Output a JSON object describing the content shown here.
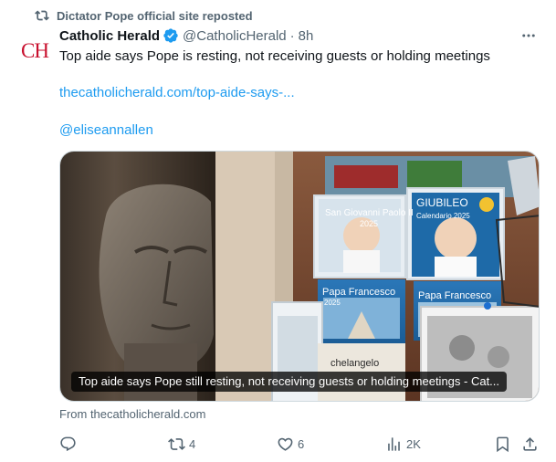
{
  "repost": {
    "text": "Dictator Pope official site reposted",
    "icon": "repost-icon"
  },
  "author": {
    "avatar_text": "CH",
    "name": "Catholic Herald",
    "handle": "@CatholicHerald",
    "separator": "·",
    "time": "8h",
    "verified_icon": "verified-badge-icon",
    "verified_color": "#1d9bf0"
  },
  "tweet": {
    "text": "Top aide says Pope is resting, not receiving guests or holding meetings",
    "link": "thecatholicherald.com/top-aide-says-...",
    "mention": "@eliseannallen"
  },
  "card": {
    "image_cards": [
      {
        "title": "San Giovanni Paolo II",
        "sub": "2025"
      },
      {
        "title": "GIUBILEO",
        "sub": "Calendario 2025"
      },
      {
        "title": "Papa Francesco",
        "sub": "2025"
      },
      {
        "title": "Papa Francesco",
        "sub": ""
      },
      {
        "title": "chelangelo",
        "sub": ""
      }
    ],
    "caption": "Top aide says Pope still resting, not receiving guests or holding meetings - Cat...",
    "source": "From thecatholicherald.com"
  },
  "actions": {
    "reply": {
      "icon": "reply-icon",
      "count": ""
    },
    "repost": {
      "icon": "repost-icon",
      "count": "4"
    },
    "like": {
      "icon": "heart-icon",
      "count": "6"
    },
    "views": {
      "icon": "views-icon",
      "count": "2K"
    },
    "bookmark": {
      "icon": "bookmark-icon"
    },
    "share": {
      "icon": "share-icon"
    }
  },
  "colors": {
    "text": "#0f1419",
    "secondary": "#536471",
    "link": "#1d9bf0",
    "brand_red": "#c8102e"
  }
}
